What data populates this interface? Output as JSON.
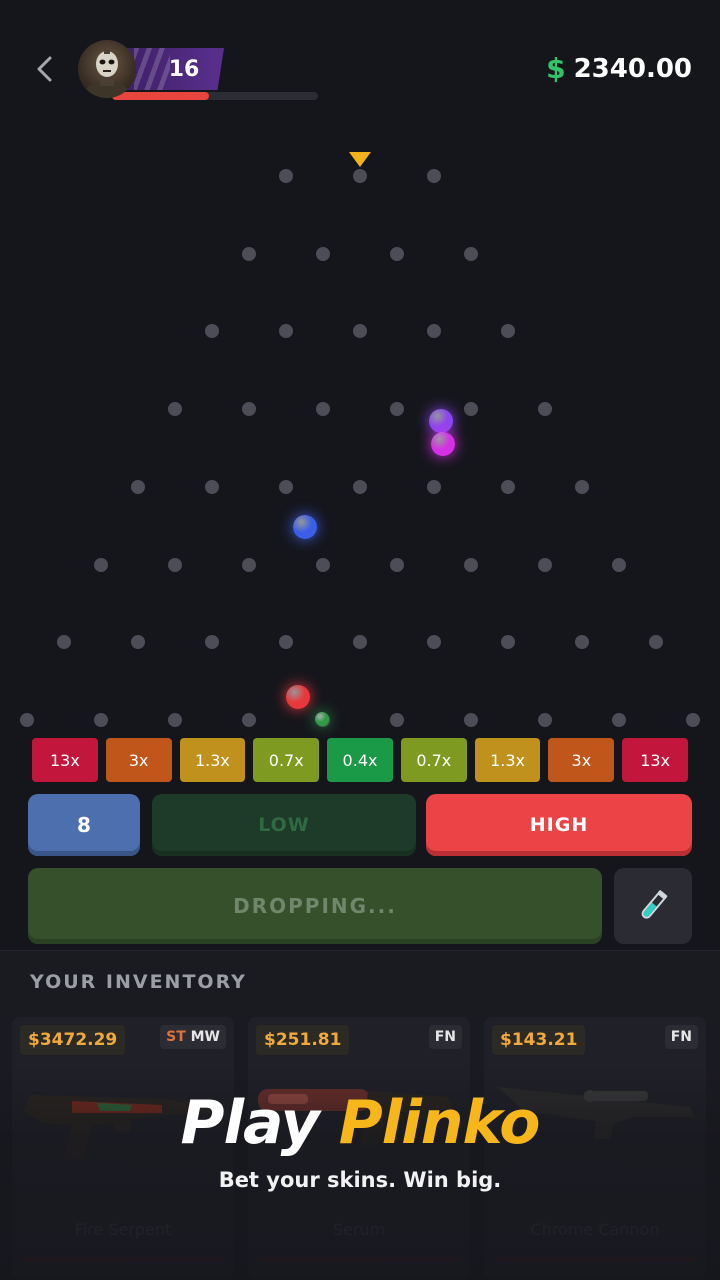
{
  "header": {
    "level": "16",
    "xp_fraction": 0.47,
    "currency_symbol": "$",
    "balance": "2340.00"
  },
  "board": {
    "rows": [
      3,
      4,
      5,
      6,
      7,
      8,
      9,
      10
    ],
    "balls": [
      {
        "name": "purple",
        "color": "#8b46f0"
      },
      {
        "name": "magenta",
        "color": "#d630e6"
      },
      {
        "name": "blue",
        "color": "#3a5fe6"
      },
      {
        "name": "red",
        "color": "#e8383c"
      },
      {
        "name": "green",
        "color": "#2f9b45"
      }
    ]
  },
  "multipliers": [
    {
      "label": "13x",
      "color": "#c3163d"
    },
    {
      "label": "3x",
      "color": "#c1561a"
    },
    {
      "label": "1.3x",
      "color": "#c0911c"
    },
    {
      "label": "0.7x",
      "color": "#7e9a21"
    },
    {
      "label": "0.4x",
      "color": "#1a9a46"
    },
    {
      "label": "0.7x",
      "color": "#7e9a21"
    },
    {
      "label": "1.3x",
      "color": "#c0911c"
    },
    {
      "label": "3x",
      "color": "#c1561a"
    },
    {
      "label": "13x",
      "color": "#c3163d"
    }
  ],
  "controls": {
    "rows_value": "8",
    "low_label": "LOW",
    "high_label": "HIGH",
    "drop_label": "DROPPING..."
  },
  "inventory": {
    "title": "YOUR INVENTORY",
    "items": [
      {
        "price": "$3472.29",
        "cond_prefix": "ST",
        "cond": "MW",
        "name": "Fire Serpent"
      },
      {
        "price": "$251.81",
        "cond_prefix": "",
        "cond": "FN",
        "name": "Serum"
      },
      {
        "price": "$143.21",
        "cond_prefix": "",
        "cond": "FN",
        "name": "Chrome Cannon"
      }
    ]
  },
  "promo": {
    "title_white": "Play",
    "title_yellow": "Plinko",
    "subtitle": "Bet your skins. Win big."
  }
}
